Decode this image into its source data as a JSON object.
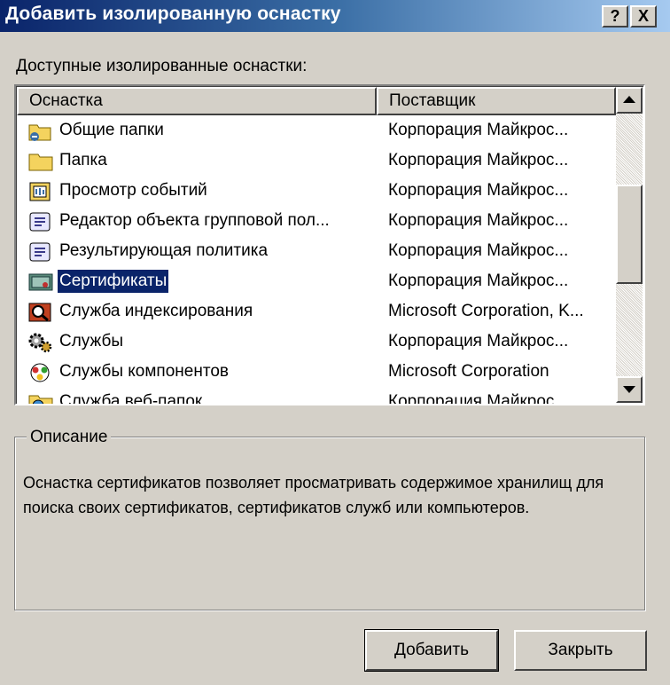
{
  "window": {
    "title": "Добавить изолированную оснастку",
    "help_label": "?",
    "close_label": "X"
  },
  "available_label": "Доступные изолированные оснастки:",
  "list": {
    "columns": [
      "Оснастка",
      "Поставщик"
    ],
    "rows": [
      {
        "name": "Общие папки",
        "vendor": "Корпорация Майкрос...",
        "icon": "shared-folder-icon",
        "selected": false
      },
      {
        "name": "Папка",
        "vendor": "Корпорация Майкрос...",
        "icon": "folder-icon",
        "selected": false
      },
      {
        "name": "Просмотр событий",
        "vendor": "Корпорация Майкрос...",
        "icon": "event-viewer-icon",
        "selected": false
      },
      {
        "name": "Редактор объекта групповой пол...",
        "vendor": "Корпорация Майкрос...",
        "icon": "policy-scroll-icon",
        "selected": false
      },
      {
        "name": "Результирующая политика",
        "vendor": "Корпорация Майкрос...",
        "icon": "policy-scroll-icon",
        "selected": false
      },
      {
        "name": "Сертификаты",
        "vendor": "Корпорация Майкрос...",
        "icon": "certificates-icon",
        "selected": true
      },
      {
        "name": "Служба индексирования",
        "vendor": "Microsoft Corporation, K...",
        "icon": "indexing-service-icon",
        "selected": false
      },
      {
        "name": "Службы",
        "vendor": "Корпорация Майкрос...",
        "icon": "services-gears-icon",
        "selected": false
      },
      {
        "name": "Службы компонентов",
        "vendor": "Microsoft Corporation",
        "icon": "component-services-icon",
        "selected": false
      },
      {
        "name": "Служба веб-папок",
        "vendor": "Корпорация Майкрос...",
        "icon": "web-folder-icon",
        "selected": false
      }
    ]
  },
  "description": {
    "title": "Описание",
    "text": "Оснастка сертификатов позволяет просматривать содержимое хранилищ для поиска своих сертификатов, сертификатов служб или компьютеров."
  },
  "buttons": {
    "add": "Добавить",
    "close": "Закрыть"
  },
  "colors": {
    "selection": "#0a246a",
    "face": "#d4d0c8"
  }
}
